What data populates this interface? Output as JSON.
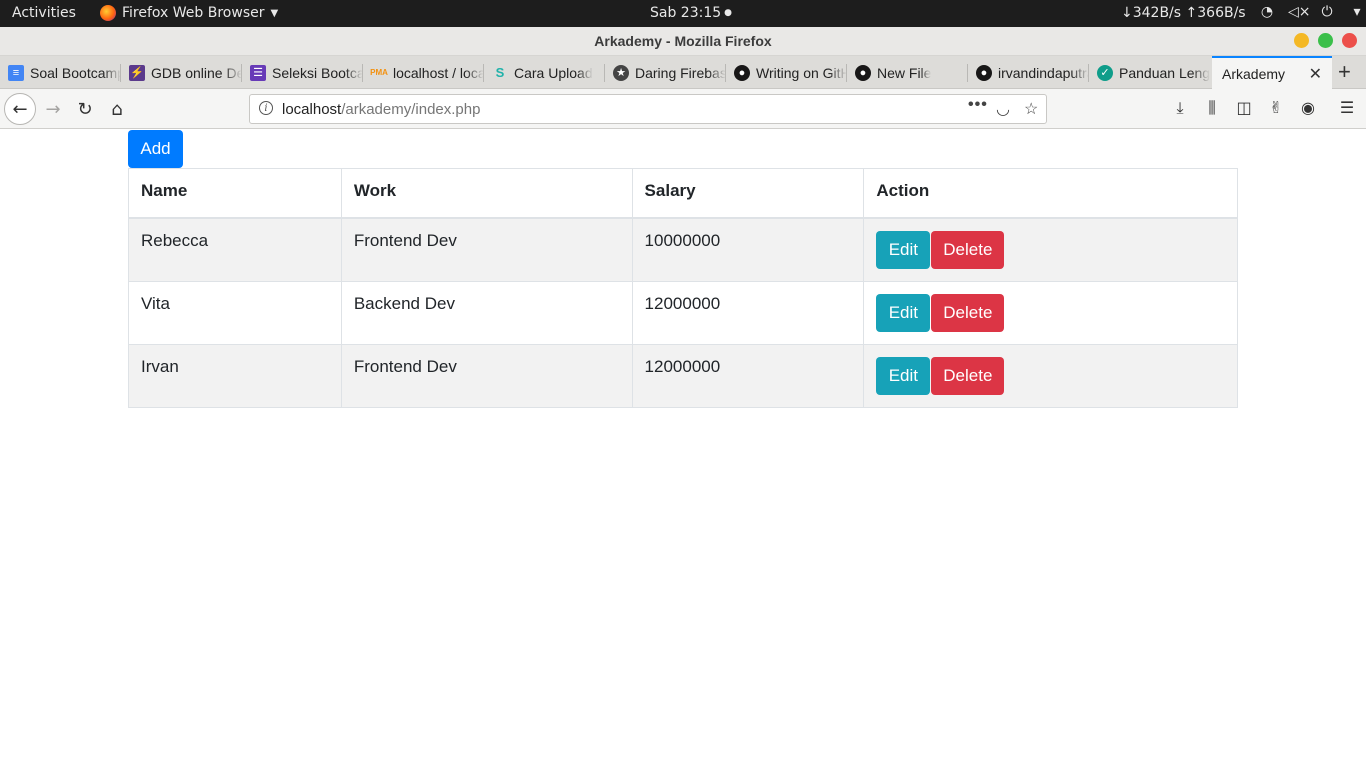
{
  "system_bar": {
    "activities": "Activities",
    "app_name": "Firefox Web Browser",
    "clock": "Sab 23:15",
    "network": "↓342B/s ↑366B/s"
  },
  "window": {
    "title": "Arkademy - Mozilla Firefox"
  },
  "tabs": [
    {
      "label": "Soal Bootcamp",
      "favicon": "docs-icon",
      "color": "#4285f4"
    },
    {
      "label": "GDB online Debugger",
      "favicon": "gdb-icon",
      "color": "#5b3a8c"
    },
    {
      "label": "Seleksi Bootcamp",
      "favicon": "forms-icon",
      "color": "#673ab7"
    },
    {
      "label": "localhost / localhost",
      "favicon": "phpmyadmin-icon",
      "color": "#f29111"
    },
    {
      "label": "Cara Upload",
      "favicon": "s-icon",
      "color": "#20b2aa"
    },
    {
      "label": "Daring Firebase",
      "favicon": "daring-icon",
      "color": "#444444"
    },
    {
      "label": "Writing on GitHub",
      "favicon": "github-icon",
      "color": "#181717"
    },
    {
      "label": "New File",
      "favicon": "github-icon",
      "color": "#181717"
    },
    {
      "label": "irvandindaputra",
      "favicon": "github-icon",
      "color": "#181717"
    },
    {
      "label": "Panduan Lengkap",
      "favicon": "panduan-icon",
      "color": "#0f9d8a"
    },
    {
      "label": "Arkademy",
      "favicon": "",
      "color": "",
      "active": true
    }
  ],
  "address_bar": {
    "host": "localhost",
    "path": "/arkademy/index.php"
  },
  "page": {
    "add_label": "Add",
    "columns": [
      "Name",
      "Work",
      "Salary",
      "Action"
    ],
    "rows": [
      {
        "name": "Rebecca",
        "work": "Frontend Dev",
        "salary": "10000000"
      },
      {
        "name": "Vita",
        "work": "Backend Dev",
        "salary": "12000000"
      },
      {
        "name": "Irvan",
        "work": "Frontend Dev",
        "salary": "12000000"
      }
    ],
    "edit_label": "Edit",
    "delete_label": "Delete"
  },
  "colors": {
    "primary": "#007bff",
    "info": "#17a2b8",
    "danger": "#dc3545"
  }
}
